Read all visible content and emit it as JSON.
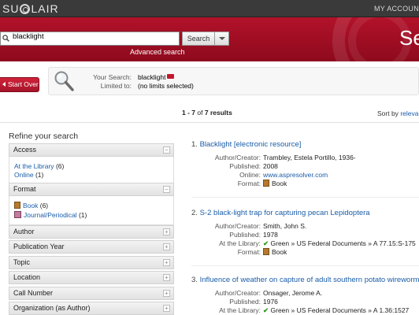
{
  "topbar": {
    "logo_left": "SU",
    "logo_right": "LAIR",
    "my_account": "MY ACCOUN"
  },
  "header": {
    "search_value": "blacklight",
    "search_button": "Search",
    "advanced_link": "Advanced search",
    "page_title": "Se"
  },
  "summary": {
    "start_over": "Start Over",
    "your_search_label": "Your Search:",
    "your_search_value": "blacklight",
    "limited_to_label": "Limited to:",
    "limited_to_value": "(no limits selected)"
  },
  "results_count": {
    "range": "1 - 7",
    "of": "of",
    "total": "7",
    "suffix": "results"
  },
  "sort": {
    "label": "Sort by",
    "value": "relevan"
  },
  "facets": {
    "heading": "Refine your search",
    "groups": [
      {
        "label": "Access",
        "toggle": "−"
      },
      {
        "label": "Format",
        "toggle": "−"
      },
      {
        "label": "Author",
        "toggle": "+"
      },
      {
        "label": "Publication Year",
        "toggle": "+"
      },
      {
        "label": "Topic",
        "toggle": "+"
      },
      {
        "label": "Location",
        "toggle": "+"
      },
      {
        "label": "Call Number",
        "toggle": "+"
      },
      {
        "label": "Organization (as Author)",
        "toggle": "+"
      }
    ],
    "access_items": [
      {
        "label": "At the Library",
        "count": "(6)"
      },
      {
        "label": "Online",
        "count": "(1)"
      }
    ],
    "format_items": [
      {
        "label": "Book",
        "count": "(6)"
      },
      {
        "label": "Journal/Periodical",
        "count": "(1)"
      }
    ]
  },
  "results": [
    {
      "number": "1.",
      "title": "Blacklight [electronic resource]",
      "fields": [
        {
          "label": "Author/Creator:",
          "value": "Trambley, Estela Portillo, 1936-"
        },
        {
          "label": "Published:",
          "value": "2008"
        },
        {
          "label": "Online:",
          "value": "www.aspresolver.com"
        },
        {
          "label": "Format:",
          "value": "Book"
        }
      ]
    },
    {
      "number": "2.",
      "title": "S-2 black-light trap for capturing pecan Lepidoptera",
      "fields": [
        {
          "label": "Author/Creator:",
          "value": "Smith, John S."
        },
        {
          "label": "Published:",
          "value": "1978"
        },
        {
          "label": "At the Library:",
          "value": "Green » US Federal Documents » A 77.15:S-175"
        },
        {
          "label": "Format:",
          "value": "Book"
        }
      ]
    },
    {
      "number": "3.",
      "title": "Influence of weather on capture of adult southern potato wireworm",
      "fields": [
        {
          "label": "Author/Creator:",
          "value": "Onsager, Jerome A."
        },
        {
          "label": "Published:",
          "value": "1976"
        },
        {
          "label": "At the Library:",
          "value": "Green » US Federal Documents » A 1.36:1527"
        }
      ]
    }
  ]
}
